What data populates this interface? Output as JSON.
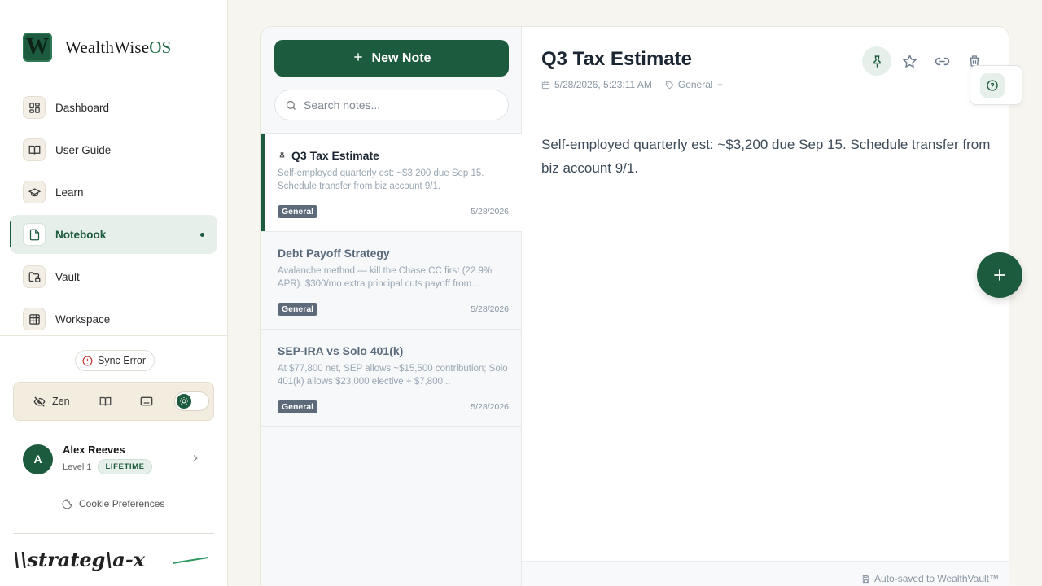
{
  "brand": {
    "logo_letter": "W",
    "name": "WealthWise",
    "suffix": "OS"
  },
  "sidebar": {
    "items": [
      {
        "label": "Dashboard",
        "icon": "grid-icon"
      },
      {
        "label": "User Guide",
        "icon": "book-open-icon"
      },
      {
        "label": "Learn",
        "icon": "graduation-cap-icon"
      },
      {
        "label": "Notebook",
        "icon": "file-icon",
        "active": true
      },
      {
        "label": "Vault",
        "icon": "folder-lock-icon"
      },
      {
        "label": "Workspace",
        "icon": "table-icon"
      }
    ],
    "sync_status": "Sync Error",
    "toolbar": {
      "zen_label": "Zen"
    },
    "user": {
      "initial": "A",
      "name": "Alex Reeves",
      "level": "Level 1",
      "badge": "LIFETIME"
    },
    "cookie_label": "Cookie Preferences",
    "footer_logo_text": "\\\\strateg\\a-x"
  },
  "notes_panel": {
    "new_note_label": "New Note",
    "search_placeholder": "Search notes...",
    "notes": [
      {
        "title": "Q3 Tax Estimate",
        "pinned": true,
        "preview": "Self-employed quarterly est: ~$3,200 due Sep 15. Schedule transfer from biz account 9/1.",
        "tag": "General",
        "date": "5/28/2026"
      },
      {
        "title": "Debt Payoff Strategy",
        "pinned": false,
        "preview": "Avalanche method — kill the Chase CC first (22.9% APR). $300/mo extra principal cuts payoff from...",
        "tag": "General",
        "date": "5/28/2026"
      },
      {
        "title": "SEP-IRA vs Solo 401(k)",
        "pinned": false,
        "preview": "At $77,800 net, SEP allows ~$15,500 contribution; Solo 401(k) allows $23,000 elective + $7,800...",
        "tag": "General",
        "date": "5/28/2026"
      }
    ]
  },
  "editor": {
    "title": "Q3 Tax Estimate",
    "timestamp": "5/28/2026, 5:23:11 AM",
    "category": "General",
    "body": "Self-employed quarterly est: ~$3,200 due Sep 15. Schedule transfer from biz account 9/1.",
    "autosave": "Auto-saved to WealthVault™"
  },
  "colors": {
    "brand": "#1d5b3e",
    "brand_light": "#e6efe9",
    "error": "#c73a3a"
  }
}
